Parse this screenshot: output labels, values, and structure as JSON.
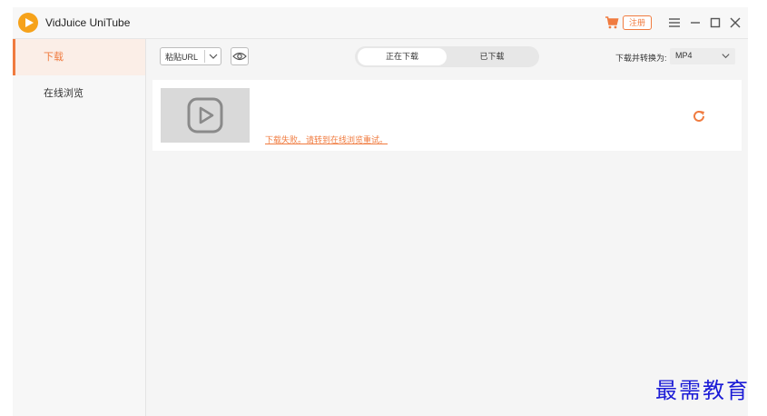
{
  "app": {
    "title": "VidJuice UniTube"
  },
  "header": {
    "register_label": "注册"
  },
  "sidebar": {
    "items": [
      {
        "label": "下载"
      },
      {
        "label": "在线浏览"
      }
    ]
  },
  "toolbar": {
    "paste_label": "粘贴URL",
    "tabs": [
      {
        "label": "正在下载"
      },
      {
        "label": "已下载"
      }
    ],
    "convert_label": "下载并转换为:",
    "format_value": "MP4"
  },
  "download": {
    "error_message": "下载失败。请转到在线浏览重试。"
  },
  "watermark": {
    "text": "最需教育"
  },
  "colors": {
    "accent": "#f07b3f",
    "watermark": "#1b1bd6"
  }
}
